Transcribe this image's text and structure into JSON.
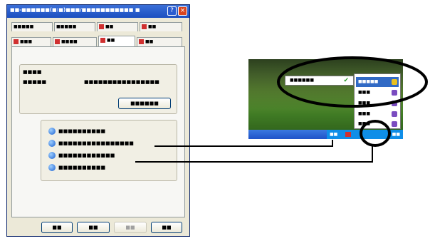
{
  "dialog": {
    "title": "■■-■■■■■■(■:■)■■■/■■■■■■■■■■■ ■",
    "tabs_row1": [
      {
        "label": "■■■■■"
      },
      {
        "label": "■■■■■"
      },
      {
        "label": "■■"
      },
      {
        "label": "■■"
      }
    ],
    "tabs_row2": [
      {
        "label": "■■■"
      },
      {
        "label": "■■■■"
      },
      {
        "label": "■■"
      },
      {
        "label": "■■"
      }
    ],
    "group1": {
      "header": "■■■■",
      "field_label": "■■■■■",
      "field_value": "■■■■■■■■■■■■■■■■",
      "button": "■■■■■■"
    },
    "options": [
      {
        "label": "■■■■■■■■■■"
      },
      {
        "label": "■■■■■■■■■■■■■■■■"
      },
      {
        "label": "■■■■■■■■■■■■"
      },
      {
        "label": "■■■■■■■■■■"
      }
    ],
    "buttons": {
      "ok": "■■",
      "cancel": "■■",
      "apply": "■■",
      "help": "■■"
    }
  },
  "snippet": {
    "popup_text": "■■■■■■",
    "menu_items": [
      {
        "label": "■■■■■"
      },
      {
        "label": "■■■"
      },
      {
        "label": "■■■"
      },
      {
        "label": "■■■"
      },
      {
        "label": "■■■"
      }
    ],
    "tray_label": "■■",
    "clock": "■■"
  },
  "colors": {
    "titlebar": "#1c4fc0",
    "callout": "#000000",
    "menu_highlight": "#316ac5"
  }
}
